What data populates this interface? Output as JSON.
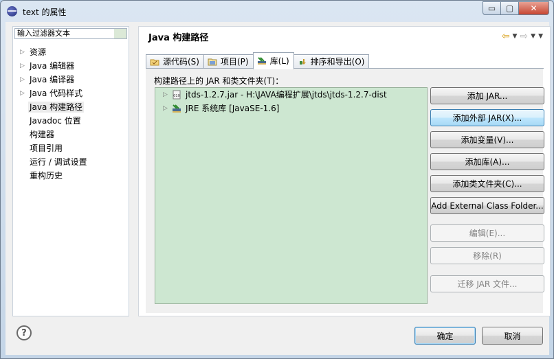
{
  "window": {
    "title": "text 的属性"
  },
  "window_buttons": {
    "minimize": "▭",
    "maximize": "▢",
    "close": "✕"
  },
  "filter": {
    "placeholder": "输入过滤器文本"
  },
  "tree": {
    "items": [
      {
        "label": "资源",
        "expandable": true
      },
      {
        "label": "Java 编辑器",
        "expandable": true
      },
      {
        "label": "Java 编译器",
        "expandable": true
      },
      {
        "label": "Java 代码样式",
        "expandable": true
      },
      {
        "label": "Java 构建路径",
        "expandable": false,
        "selected": true
      },
      {
        "label": "Javadoc 位置",
        "expandable": false
      },
      {
        "label": "构建器",
        "expandable": false
      },
      {
        "label": "项目引用",
        "expandable": false
      },
      {
        "label": "运行 / 调试设置",
        "expandable": false
      },
      {
        "label": "重构历史",
        "expandable": false
      }
    ]
  },
  "page": {
    "title": "Java 构建路径"
  },
  "tabs": [
    {
      "label": "源代码(S)",
      "icon": "source-folder-icon"
    },
    {
      "label": "项目(P)",
      "icon": "project-folder-icon"
    },
    {
      "label": "库(L)",
      "icon": "library-icon",
      "active": true
    },
    {
      "label": "排序和导出(O)",
      "icon": "order-export-icon"
    }
  ],
  "libraries": {
    "label": "构建路径上的 JAR 和类文件夹(T)：",
    "entries": [
      {
        "label": "jtds-1.2.7.jar  -  H:\\JAVA编程扩展\\jtds\\jtds-1.2.7-dist",
        "icon": "jar-file-icon"
      },
      {
        "label": "JRE 系统库 [JavaSE-1.6]",
        "icon": "jre-library-icon"
      }
    ]
  },
  "buttons": {
    "add_jar": "添加 JAR...",
    "add_external_jar": "添加外部 JAR(X)...",
    "add_variable": "添加变量(V)...",
    "add_library": "添加库(A)...",
    "add_class_folder": "添加类文件夹(C)...",
    "add_external_class_folder": "Add External Class Folder...",
    "edit": "编辑(E)...",
    "remove": "移除(R)",
    "migrate_jar": "迁移 JAR 文件..."
  },
  "footer": {
    "ok": "确定",
    "cancel": "取消",
    "help": "?"
  },
  "colors": {
    "list_bg": "#cde7d1",
    "focus_blue": "#3c7fb1"
  }
}
